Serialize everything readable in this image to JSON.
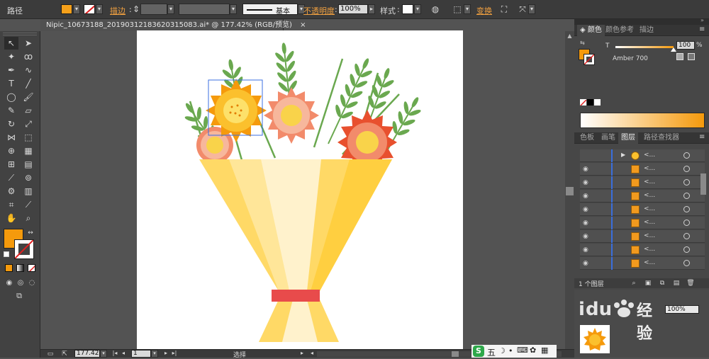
{
  "control_bar": {
    "object_type": "路径",
    "stroke_label": "描边",
    "stroke_style": "基本",
    "opacity_label": "不透明度",
    "opacity_value": "100%",
    "style_label": "样式",
    "transform_label": "变换",
    "fill_color": "#f5a01a"
  },
  "document": {
    "tab_title": "Nipic_10673188_20190312183620315083.ai* @ 177.42% (RGB/预览)",
    "close_glyph": "×"
  },
  "color_panel": {
    "tabs": [
      "颜色",
      "颜色参考",
      "描边"
    ],
    "t_label": "T",
    "tint_value": "100",
    "percent": "%",
    "color_name": "Amber 700",
    "gradient_from": "#ffffff",
    "gradient_to": "#f59a0c"
  },
  "layers_panel": {
    "tabs": [
      "色板",
      "画笔",
      "图层",
      "路径查找器"
    ],
    "row_label": "<...",
    "footer_count": "1 个图层"
  },
  "status_bar": {
    "zoom": "177.42",
    "page": "1",
    "tool_label": "选择"
  },
  "watermark": {
    "brand": "经验"
  },
  "taskbar": {
    "ime_label": "五"
  }
}
